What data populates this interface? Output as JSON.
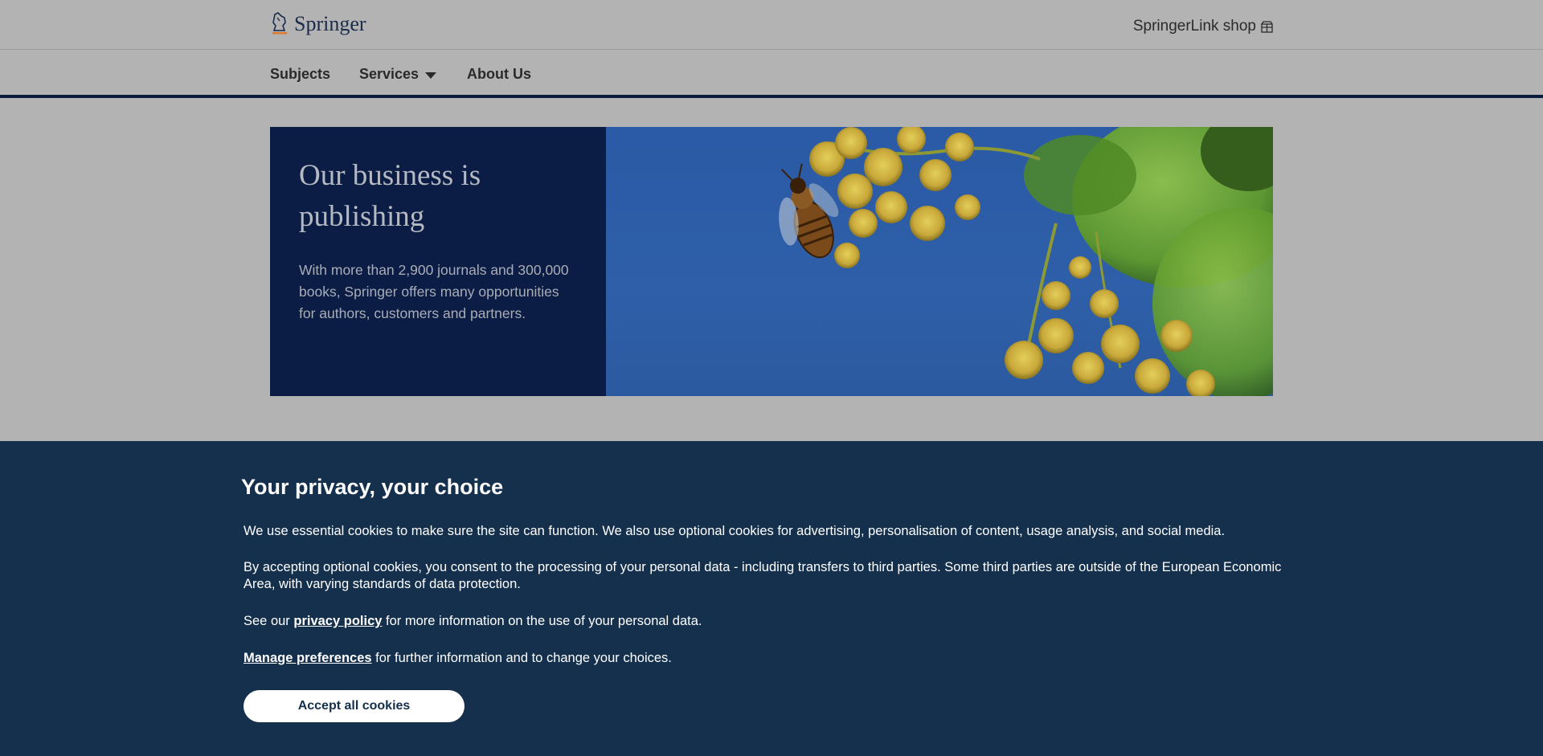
{
  "header": {
    "logo_text": "Springer",
    "shop_label": "SpringerLink shop"
  },
  "nav": {
    "items": [
      {
        "label": "Subjects"
      },
      {
        "label": "Services"
      },
      {
        "label": "About Us"
      }
    ]
  },
  "hero": {
    "title": "Our business is publishing",
    "description": "With more than 2,900 journals and 300,000 books, Springer offers many opportunities for authors, customers and partners."
  },
  "cookie": {
    "title": "Your privacy, your choice",
    "p1": "We use essential cookies to make sure the site can function. We also use optional cookies for advertising, personalisation of content, usage analysis, and social media.",
    "p2": "By accepting optional cookies, you consent to the processing of your personal data - including transfers to third parties. Some third parties are outside of the European Economic Area, with varying standards of data protection.",
    "p3_prefix": "See our ",
    "p3_link": "privacy policy",
    "p3_suffix": " for more information on the use of your personal data.",
    "p4_link": "Manage preferences",
    "p4_suffix": " for further information and to change your choices.",
    "accept_label": "Accept all cookies"
  },
  "colors": {
    "banner_bg": "#14304c",
    "nav_underline": "#0b1c3c",
    "hero_text_bg": "#0b1c45"
  }
}
